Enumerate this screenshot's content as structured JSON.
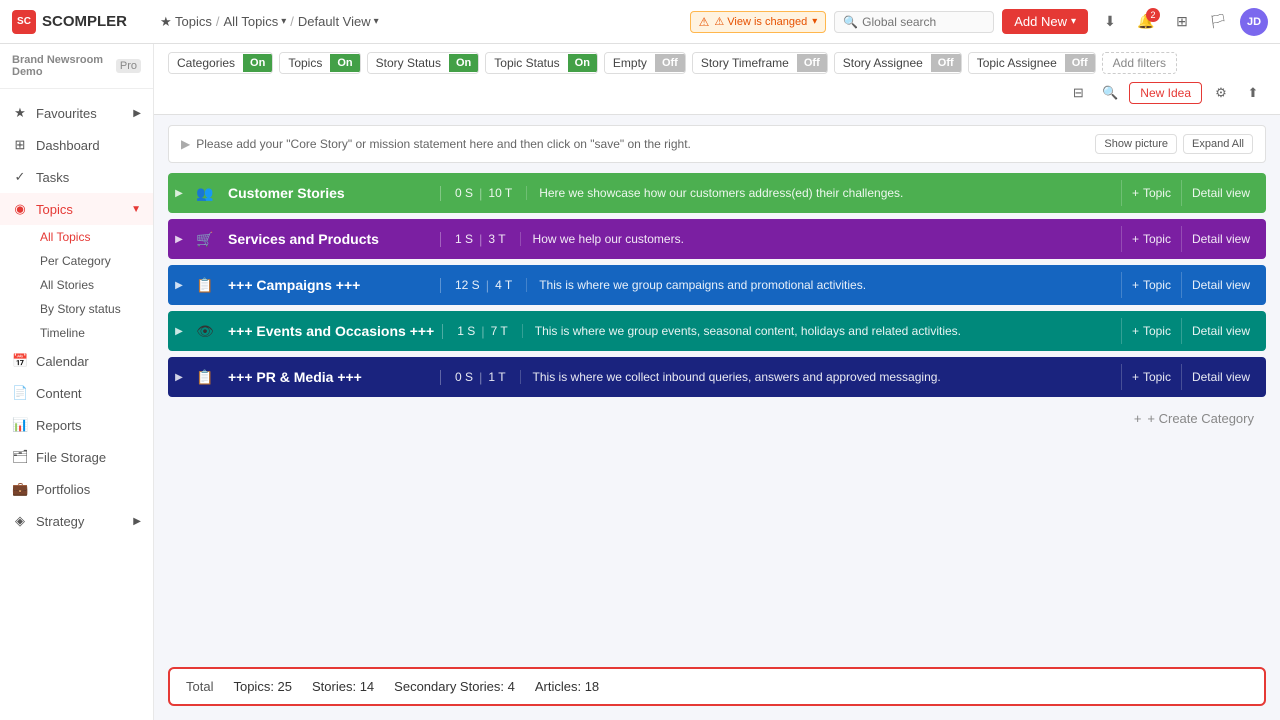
{
  "app": {
    "name": "SCOMPLER",
    "logo_text": "SC"
  },
  "breadcrumb": {
    "item1": "Topics",
    "sep1": "/",
    "item2": "All Topics",
    "sep2": "/",
    "item3": "Default View"
  },
  "view_changed": {
    "label": "⚠ View is changed"
  },
  "search": {
    "placeholder": "Global search"
  },
  "add_new": {
    "label": "Add New"
  },
  "brand": {
    "name": "Brand Newsroom Demo",
    "plan": "Pro"
  },
  "sidebar": {
    "items": [
      {
        "label": "Favourites",
        "icon": "★",
        "has_arrow": true
      },
      {
        "label": "Dashboard",
        "icon": "⊞"
      },
      {
        "label": "Tasks",
        "icon": "✓"
      },
      {
        "label": "Topics",
        "icon": "◉",
        "active": true,
        "has_arrow": true
      },
      {
        "label": "Calendar",
        "icon": "📅"
      },
      {
        "label": "Content",
        "icon": "📄"
      },
      {
        "label": "Reports",
        "icon": "📊"
      },
      {
        "label": "File Storage",
        "icon": "🗂"
      },
      {
        "label": "Portfolios",
        "icon": "💼"
      },
      {
        "label": "Strategy",
        "icon": "◈",
        "has_arrow": true
      }
    ],
    "topics_sub": [
      {
        "label": "All Topics",
        "active": true
      },
      {
        "label": "Per Category"
      },
      {
        "label": "All Stories"
      },
      {
        "label": "By Story status"
      },
      {
        "label": "Timeline"
      }
    ]
  },
  "filters": [
    {
      "label": "Categories",
      "status": "On",
      "on": true
    },
    {
      "label": "Topics",
      "status": "On",
      "on": true
    },
    {
      "label": "Story Status",
      "status": "On",
      "on": true
    },
    {
      "label": "Topic Status",
      "status": "On",
      "on": true
    },
    {
      "label": "Empty",
      "status": "Off",
      "on": false
    },
    {
      "label": "Story Timeframe",
      "status": "Off",
      "on": false
    },
    {
      "label": "Story Assignee",
      "status": "Off",
      "on": false
    },
    {
      "label": "Topic Assignee",
      "status": "Off",
      "on": false
    }
  ],
  "add_filters": "Add filters",
  "new_idea": "New Idea",
  "mission": {
    "text": "Please add your \"Core Story\" or mission statement here and then click on \"save\" on the right.",
    "show_picture": "Show picture",
    "expand_all": "Expand All"
  },
  "categories": [
    {
      "name": "Customer Stories",
      "icon": "👥",
      "stories": "0 S",
      "topics": "10 T",
      "desc": "Here we showcase how our customers address(ed) their challenges.",
      "color": "row-green",
      "add_topic": "+ Topic",
      "detail": "Detail view"
    },
    {
      "name": "Services and Products",
      "icon": "🛒",
      "stories": "1 S",
      "topics": "3 T",
      "desc": "How we help our customers.",
      "color": "row-purple",
      "add_topic": "+ Topic",
      "detail": "Detail view"
    },
    {
      "name": "+++ Campaigns +++",
      "icon": "📋",
      "stories": "12 S",
      "topics": "4 T",
      "desc": "This is where we group campaigns and promotional activities.",
      "color": "row-blue",
      "add_topic": "+ Topic",
      "detail": "Detail view"
    },
    {
      "name": "+++ Events and Occasions +++",
      "icon": "👁",
      "stories": "1 S",
      "topics": "7 T",
      "desc": "This is where we group events, seasonal content, holidays and related activities.",
      "color": "row-teal",
      "add_topic": "+ Topic",
      "detail": "Detail view"
    },
    {
      "name": "+++ PR & Media +++",
      "icon": "📋",
      "stories": "0 S",
      "topics": "1 T",
      "desc": "This is where we collect inbound queries, answers and approved messaging.",
      "color": "row-darkblue",
      "add_topic": "+ Topic",
      "detail": "Detail view"
    }
  ],
  "create_category": "+ Create Category",
  "status_bar": {
    "total_label": "Total",
    "topics": "Topics: 25",
    "stories": "Stories: 14",
    "secondary_stories": "Secondary Stories: 4",
    "articles": "Articles: 18"
  }
}
